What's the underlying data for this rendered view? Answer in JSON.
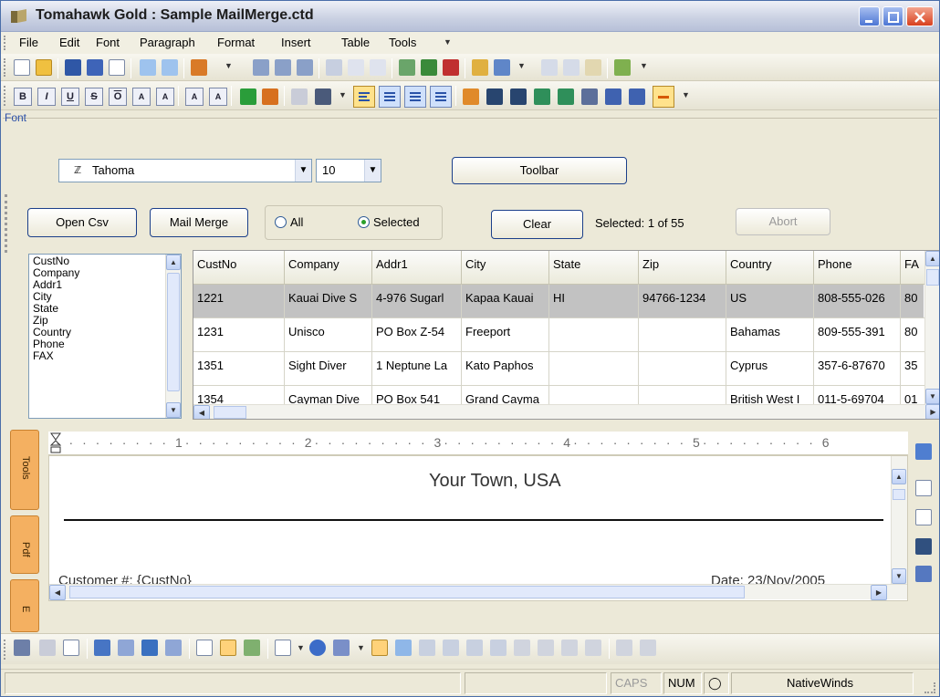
{
  "window": {
    "title": "Tomahawk Gold : Sample MailMerge.ctd"
  },
  "menu": [
    "File",
    "Edit",
    "Font",
    "Paragraph",
    "Format",
    "Insert",
    "Table",
    "Tools"
  ],
  "font_panel": {
    "label": "Font",
    "font_name": "Tahoma",
    "font_size": "10",
    "toolbar_button": "Toolbar"
  },
  "merge": {
    "open_csv": "Open Csv",
    "mail_merge": "Mail Merge",
    "radio_all": "All",
    "radio_selected": "Selected",
    "clear": "Clear",
    "selected_status": "Selected: 1 of 55",
    "abort": "Abort"
  },
  "field_list": [
    "CustNo",
    "Company",
    "Addr1",
    "City",
    "State",
    "Zip",
    "Country",
    "Phone",
    "FAX"
  ],
  "grid": {
    "columns": [
      "CustNo",
      "Company",
      "Addr1",
      "City",
      "State",
      "Zip",
      "Country",
      "Phone",
      "FA"
    ],
    "rows": [
      [
        "1221",
        "Kauai Dive S",
        "4-976 Sugarl",
        "Kapaa Kauai",
        "HI",
        "94766-1234",
        "US",
        "808-555-026",
        "80"
      ],
      [
        "1231",
        "Unisco",
        "PO Box Z-54",
        "Freeport",
        "",
        "",
        "Bahamas",
        "809-555-391",
        "80"
      ],
      [
        "1351",
        "Sight Diver",
        "1 Neptune La",
        "Kato Paphos",
        "",
        "",
        "Cyprus",
        "357-6-87670",
        "35"
      ],
      [
        "1354",
        "Cayman Dive",
        "PO Box 541",
        "Grand Cayma",
        "",
        "",
        "British West I",
        "011-5-69704",
        "01"
      ]
    ]
  },
  "ruler": [
    "1",
    "2",
    "3",
    "4",
    "5",
    "6"
  ],
  "side_tabs": [
    "Tools",
    "Pdf",
    "E"
  ],
  "document": {
    "heading": "Your Town, USA",
    "customer_line": "Customer #: {CustNo}",
    "date_line": "Date: 23/Nov/2005"
  },
  "status_bar": {
    "caps": "CAPS",
    "num": "NUM",
    "brand": "NativeWinds"
  },
  "colors": {
    "title_bar": "#c9d0e2",
    "selected_row": "#c2c2c2",
    "side_tab": "#f4b061",
    "accent": "#2a53a8"
  }
}
